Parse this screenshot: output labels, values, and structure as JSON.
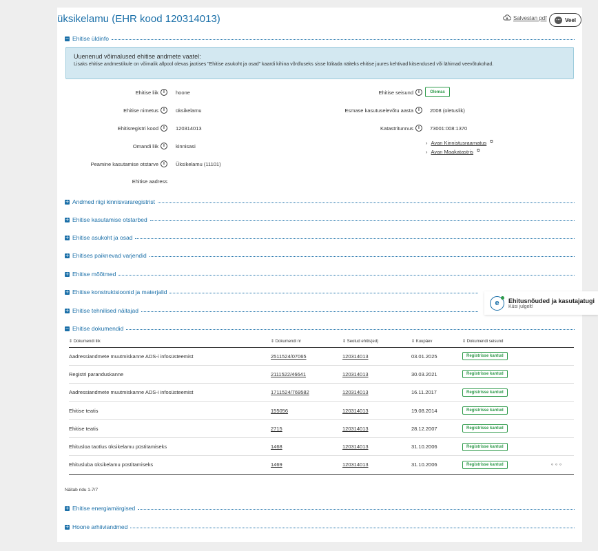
{
  "header": {
    "title": "üksikelamu (EHR kood 120314013)",
    "pdf_label": "Salvestan pdf",
    "more_label": "Veel"
  },
  "sections": {
    "general": "Ehitise üldinfo",
    "registry": "Andmed riigi kinnisvararegistrist",
    "purposes": "Ehitise kasutamise otstarbed",
    "location": "Ehitise asukoht ja osad",
    "shelters": "Ehitises paiknevad varjendid",
    "dimensions": "Ehitise mõõtmed",
    "constructions": "Ehitise konstruktsioonid ja materjalid",
    "technical": "Ehitise tehnilised näitajad",
    "documents": "Ehitise dokumendid",
    "energy": "Ehitise energiamärgised",
    "archive": "Hoone arhiiviandmed"
  },
  "infobox": {
    "heading": "Uuenenud võimalused ehitise andmete vaatel:",
    "text": "Lisaks ehitise andmestikule on võimalik allpool olevas jaotises \"Ehitise asukoht ja osad\" kaardi kihina võrdluseks sisse lülitada näiteks ehitise juures kehtivad kitsendused või lähimad veevõtukohad."
  },
  "fields": {
    "type_label": "Ehitise liik",
    "type_value": "hoone",
    "name_label": "Ehitise nimetus",
    "name_value": "üksikelamu",
    "code_label": "Ehitisregistri kood",
    "code_value": "120314013",
    "ownership_label": "Omandi liik",
    "ownership_value": "kinnisasi",
    "purpose_label": "Peamine kasutamise otstarve",
    "purpose_value": "Üksikelamu (11101)",
    "address_label": "Ehitise aadress",
    "status_label": "Ehitise seisund",
    "status_value": "Olemas",
    "first_use_label": "Esmase kasutuselevõtu aasta",
    "first_use_value": "2008 (oletuslik)",
    "cadastral_label": "Katastritunnus",
    "cadastral_value": "73001:008:1370",
    "link_land_registry": "Avan Kinnistusraamatus",
    "link_cadastre": "Avan Maakatastris"
  },
  "documents": {
    "columns": [
      "Dokumendi liik",
      "Dokumendi nr",
      "Seotud ehitis(ed)",
      "Kuupäev",
      "Dokumendi seisund"
    ],
    "rows": [
      {
        "type": "Aadressiandmete muutmiskanne ADS-i infosüsteemist",
        "nr": "2511524/07065",
        "building": "120314013",
        "date": "03.01.2025",
        "status": "Registrisse kantud"
      },
      {
        "type": "Registri paranduskanne",
        "nr": "2111522/46641",
        "building": "120314013",
        "date": "30.03.2021",
        "status": "Registrisse kantud"
      },
      {
        "type": "Aadressiandmete muutmiskanne ADS-i infosüsteemist",
        "nr": "1711524/769582",
        "building": "120314013",
        "date": "16.11.2017",
        "status": "Registrisse kantud"
      },
      {
        "type": "Ehitise teatis",
        "nr": "155056",
        "building": "120314013",
        "date": "19.08.2014",
        "status": "Registrisse kantud"
      },
      {
        "type": "Ehitise teatis",
        "nr": "2715",
        "building": "120314013",
        "date": "28.12.2007",
        "status": "Registrisse kantud"
      },
      {
        "type": "Ehitusloa taotlus üksikelamu püstitamiseks",
        "nr": "1468",
        "building": "120314013",
        "date": "31.10.2006",
        "status": "Registrisse kantud"
      },
      {
        "type": "Ehitusluba üksikelamu püstitamiseks",
        "nr": "1469",
        "building": "120314013",
        "date": "31.10.2006",
        "status": "Registrisse kantud"
      }
    ],
    "footer": "Näitab ridu 1-7/7"
  },
  "widget": {
    "title": "Ehitusnõuded ja kasutajatugi",
    "subtitle": "Küsi julgelt!"
  }
}
